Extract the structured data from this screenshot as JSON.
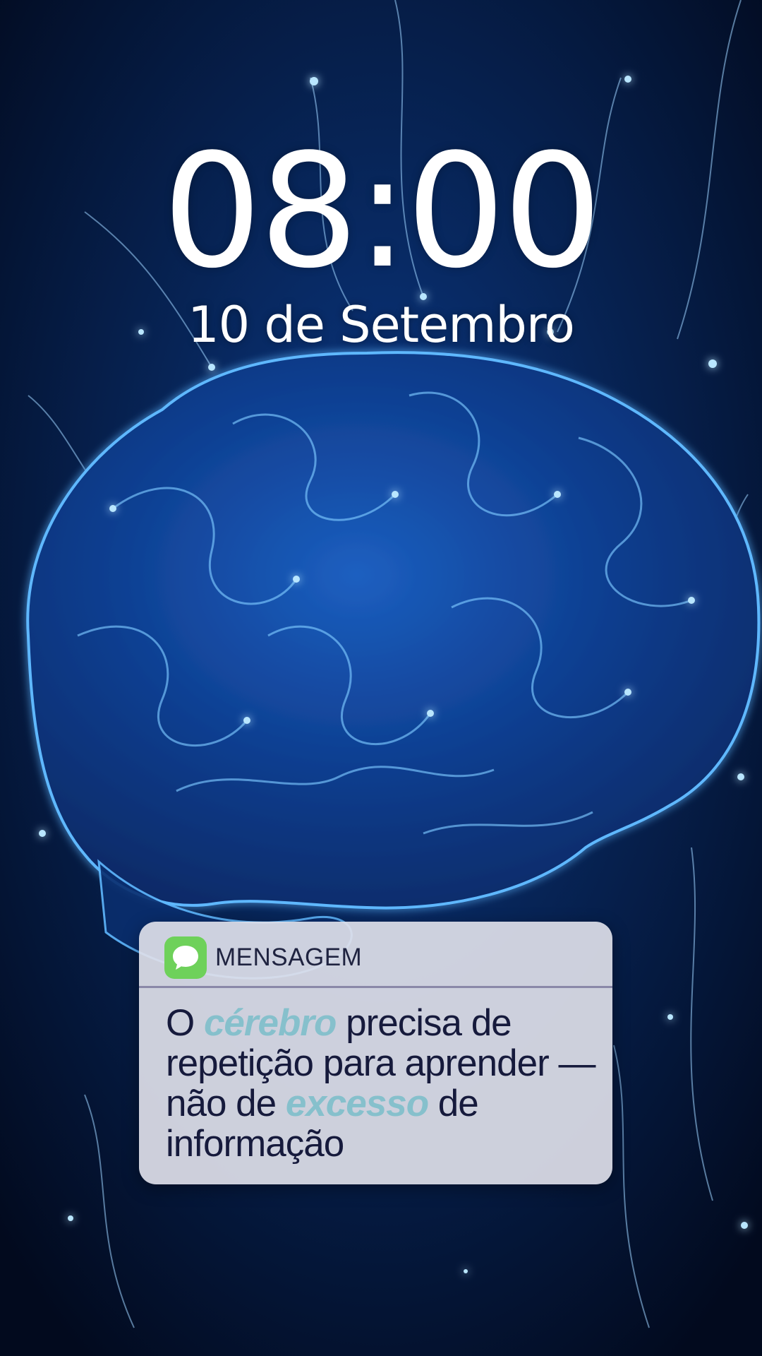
{
  "lock_screen": {
    "time": "08:00",
    "date": "10 de Setembro"
  },
  "notification": {
    "app_icon": "message-bubble-icon",
    "app_name": "MENSAGEM",
    "message": {
      "part1": "O ",
      "highlight1": "cérebro",
      "part2": " precisa de repetição para aprender — não de ",
      "highlight2": "excesso",
      "part3": " de informação"
    }
  },
  "colors": {
    "background": "#03102a",
    "brain_glow": "#2a8cff",
    "accent_text": "#86c0cc",
    "app_icon": "#6ed15a",
    "notification_bg": "#dee0e9",
    "notification_text": "#161a3c"
  }
}
